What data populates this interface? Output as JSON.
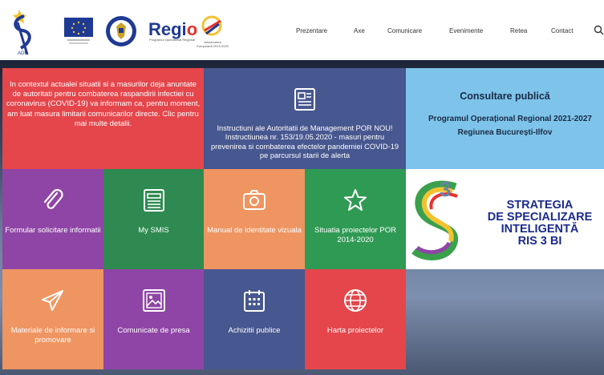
{
  "header": {
    "nav": [
      "Prezentare",
      "Axe",
      "Comunicare",
      "Evenimente",
      "Retea",
      "Contact"
    ],
    "logos": {
      "adr_text": "ADR",
      "regio_part1": "Regi",
      "regio_part2": "o",
      "regio_sub": "Programul Operațional Regional",
      "anniversary_sub": "Aniversarea Europeană 2019-2020"
    }
  },
  "tiles": {
    "covid": "In contextul actualei situatii si a masurilor deja anuntate de autoritati pentru combaterea raspandirii infectiei cu coronavirus (COVID-19) va informam ca, pentru moment, am luat masura limitarii comunicarilor directe. Clic pentru mai multe detalii.",
    "instructiuni": "Instructiuni ale Autoritatii de Management POR NOU! Instructiunea nr. 153/19.05.2020 - masuri pentru prevenirea si combaterea efectelor pandemiei COVID-19 pe parcursul starii de alerta",
    "consultare": {
      "title": "Consultare publică",
      "line1": "Programul Operațional Regional 2021-2027",
      "line2": "Regiunea București-Ilfov"
    },
    "formular": "Formular solicitare informatii",
    "smis": "My SMIS",
    "manual": "Manual de identitate vizuala",
    "situatia": "Situatia proiectelor POR 2014-2020",
    "ris": {
      "line1": "STRATEGIA",
      "line2": "DE SPECIALIZARE",
      "line3": "INTELIGENTĂ",
      "line4": "RIS 3 BI"
    },
    "materiale": "Materiale de informare si promovare",
    "comunicate": "Comunicate de presa",
    "achizitii": "Achizitii publice",
    "harta": "Harta proiectelor"
  },
  "colors": {
    "red": "#e4464b",
    "indigo": "#47578f",
    "sky": "#7ec4ea",
    "purple": "#8f45a6",
    "green": "#2e8a50",
    "orange": "#ef9561"
  }
}
